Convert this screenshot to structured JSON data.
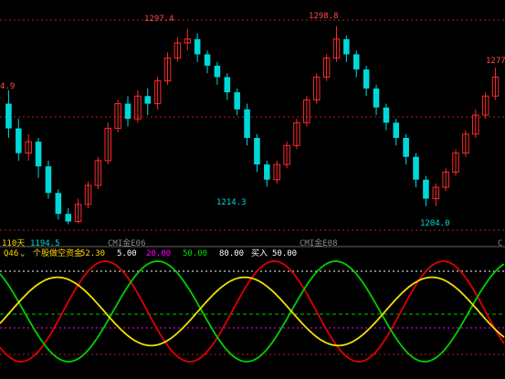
{
  "colors": {
    "background": "#000000",
    "candle_up": "#ff2a2a",
    "candle_down": "#00d8d8",
    "grid": "#c01818",
    "green_line": "#00c000",
    "osc_red": "#e00000",
    "osc_green": "#00d000",
    "osc_yellow": "#f0e000",
    "info_yellow": "#ffd800",
    "info_magenta": "#ff00ff",
    "info_green": "#00e000",
    "info_white": "#ffffff"
  },
  "price_panel": {
    "labels": {
      "high1": "1297.4",
      "high2": "1298.8",
      "high3": "1277",
      "left_edge": "4.9",
      "low1": "1194.5",
      "low2": "1214.3",
      "low3": "1204.0",
      "period": "110天",
      "date1": "CMI金E06",
      "date2": "CMI金E08",
      "date3": "C"
    },
    "candles": [
      [
        1258,
        1245,
        1265,
        1240
      ],
      [
        1245,
        1232,
        1250,
        1228
      ],
      [
        1232,
        1238,
        1242,
        1228
      ],
      [
        1238,
        1225,
        1240,
        1219
      ],
      [
        1225,
        1211,
        1228,
        1208
      ],
      [
        1211,
        1200,
        1213,
        1197
      ],
      [
        1200,
        1196,
        1203,
        1194.5
      ],
      [
        1196,
        1205,
        1208,
        1195
      ],
      [
        1205,
        1215,
        1217,
        1203
      ],
      [
        1215,
        1228,
        1230,
        1213
      ],
      [
        1228,
        1245,
        1248,
        1226
      ],
      [
        1245,
        1258,
        1260,
        1243
      ],
      [
        1258,
        1250,
        1262,
        1246
      ],
      [
        1250,
        1262,
        1265,
        1248
      ],
      [
        1262,
        1258,
        1266,
        1252
      ],
      [
        1258,
        1270,
        1272,
        1255
      ],
      [
        1270,
        1282,
        1285,
        1268
      ],
      [
        1282,
        1290,
        1293,
        1280
      ],
      [
        1290,
        1292,
        1297.4,
        1286
      ],
      [
        1292,
        1284,
        1295,
        1280
      ],
      [
        1284,
        1278,
        1286,
        1274
      ],
      [
        1278,
        1272,
        1280,
        1268
      ],
      [
        1272,
        1264,
        1274,
        1260
      ],
      [
        1264,
        1255,
        1266,
        1252
      ],
      [
        1255,
        1240,
        1258,
        1236
      ],
      [
        1240,
        1226,
        1242,
        1222
      ],
      [
        1226,
        1218,
        1228,
        1214.3
      ],
      [
        1218,
        1226,
        1228,
        1216
      ],
      [
        1226,
        1236,
        1238,
        1224
      ],
      [
        1236,
        1248,
        1250,
        1234
      ],
      [
        1248,
        1260,
        1262,
        1246
      ],
      [
        1260,
        1272,
        1274,
        1258
      ],
      [
        1272,
        1282,
        1284,
        1270
      ],
      [
        1282,
        1292,
        1298.8,
        1280
      ],
      [
        1292,
        1284,
        1294,
        1280
      ],
      [
        1284,
        1276,
        1286,
        1272
      ],
      [
        1276,
        1266,
        1278,
        1262
      ],
      [
        1266,
        1256,
        1268,
        1252
      ],
      [
        1256,
        1248,
        1258,
        1244
      ],
      [
        1248,
        1240,
        1250,
        1236
      ],
      [
        1240,
        1230,
        1242,
        1226
      ],
      [
        1230,
        1218,
        1232,
        1214
      ],
      [
        1218,
        1208,
        1220,
        1204
      ],
      [
        1208,
        1214,
        1216,
        1204.0
      ],
      [
        1214,
        1222,
        1224,
        1212
      ],
      [
        1222,
        1232,
        1234,
        1220
      ],
      [
        1232,
        1242,
        1244,
        1230
      ],
      [
        1242,
        1252,
        1255,
        1240
      ],
      [
        1252,
        1262,
        1264,
        1250
      ],
      [
        1262,
        1272,
        1277,
        1260
      ]
    ]
  },
  "info_bar": {
    "name": "Q46",
    "indicator": "个股做空资金",
    "value": "52.30",
    "level1": "5.00",
    "level2": "20.00",
    "level3": "50.00",
    "level4": "80.00",
    "signal_label": "买入",
    "signal_value": "50.00"
  }
}
